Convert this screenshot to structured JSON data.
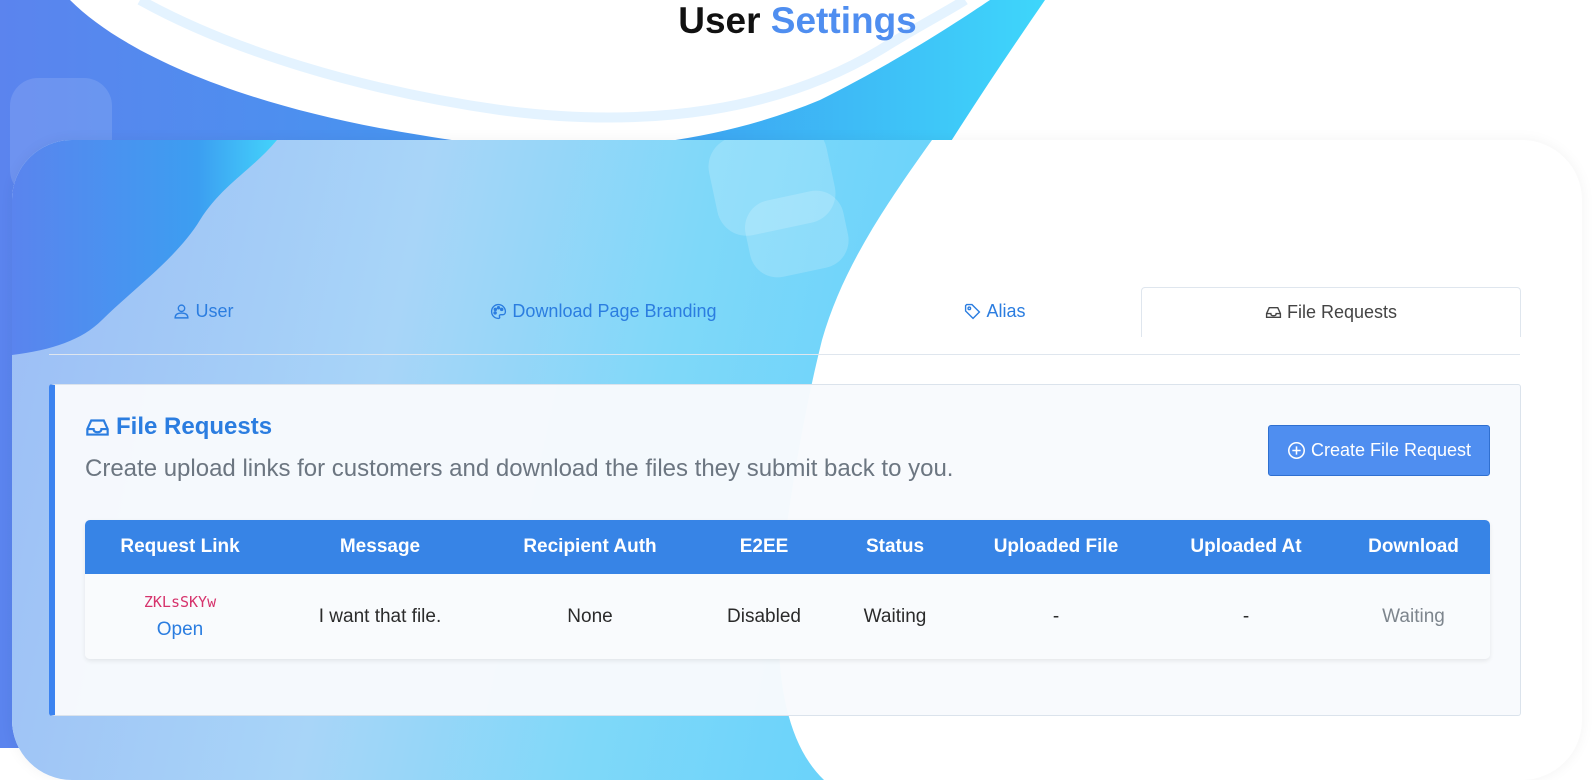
{
  "page": {
    "title_prefix": "User",
    "title_accent": "Settings"
  },
  "tabs": [
    {
      "label": "User",
      "icon": "user-icon",
      "active": false
    },
    {
      "label": "Download Page Branding",
      "icon": "palette-icon",
      "active": false
    },
    {
      "label": "Alias",
      "icon": "tag-icon",
      "active": false
    },
    {
      "label": "File Requests",
      "icon": "inbox-icon",
      "active": true
    }
  ],
  "panel": {
    "title": "File Requests",
    "title_icon": "inbox-icon",
    "subtitle": "Create upload links for customers and download the files they submit back to you.",
    "create_button": "Create File Request",
    "create_button_icon": "plus-circle-icon"
  },
  "table": {
    "headers": [
      "Request Link",
      "Message",
      "Recipient Auth",
      "E2EE",
      "Status",
      "Uploaded File",
      "Uploaded At",
      "Download"
    ],
    "rows": [
      {
        "code": "ZKLsSKYw",
        "link_label": "Open",
        "message": "I want that file.",
        "recipient_auth": "None",
        "e2ee": "Disabled",
        "status": "Waiting",
        "uploaded_file": "-",
        "uploaded_at": "-",
        "download": "Waiting"
      }
    ]
  },
  "colors": {
    "accent": "#4f8ef0",
    "link": "#2b7de0",
    "table_header": "#3784e6",
    "code": "#d6336c",
    "panel_border_left": "#3b83f0"
  }
}
